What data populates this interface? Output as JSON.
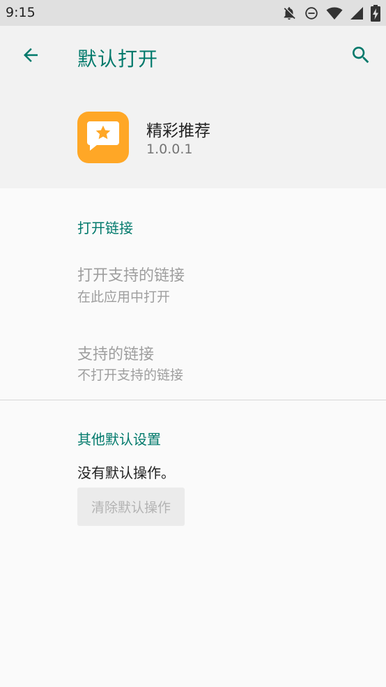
{
  "status_bar": {
    "time": "9:15",
    "icons": [
      "notifications-off-icon",
      "do-not-disturb-icon",
      "wifi-icon",
      "signal-icon",
      "battery-charging-icon"
    ]
  },
  "app_bar": {
    "title": "默认打开",
    "back_icon": "arrow-back-icon",
    "search_icon": "search-icon",
    "accent_color": "#00796b"
  },
  "app_header": {
    "name": "精彩推荐",
    "version": "1.0.0.1",
    "icon": "star-chat-icon",
    "icon_color": "#ffa726"
  },
  "links_section": {
    "title": "打开链接",
    "items": [
      {
        "title": "打开支持的链接",
        "subtitle": "在此应用中打开"
      },
      {
        "title": "支持的链接",
        "subtitle": "不打开支持的链接"
      }
    ]
  },
  "defaults_section": {
    "title": "其他默认设置",
    "status": "没有默认操作。",
    "clear_button": "清除默认操作"
  }
}
